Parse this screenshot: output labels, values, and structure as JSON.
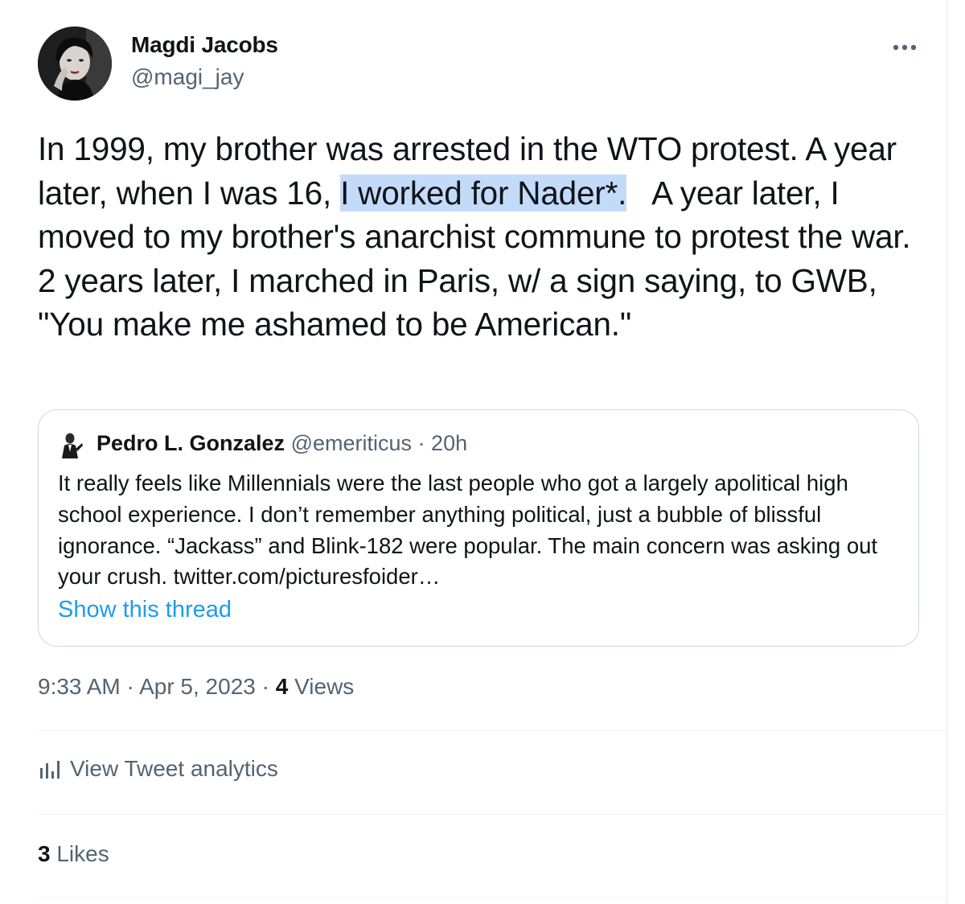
{
  "author": {
    "name": "Magdi Jacobs",
    "handle": "@magi_jay"
  },
  "more_icon": "more-horizontal-icon",
  "tweet": {
    "text_before": "In 1999, my brother was arrested in the WTO protest. A year later, when I was 16, ",
    "text_highlight": "I worked for Nader*.",
    "text_after": "   A year later, I moved to my brother's anarchist commune to protest the war. 2 years later, I marched in Paris, w/ a sign saying, to GWB, \"You make me ashamed to be American.\""
  },
  "quote": {
    "name": "Pedro L. Gonzalez",
    "handle": "@emeriticus",
    "separator": "·",
    "time": "20h",
    "text": "It really feels like Millennials were the last people who got a largely apolitical high school experience. I don’t remember anything political, just a bubble of blissful ignorance. “Jackass” and Blink-182 were popular. The main concern was asking out your crush. twitter.com/picturesfoider…",
    "show_thread": "Show this thread"
  },
  "meta": {
    "time": "9:33 AM",
    "separator": "·",
    "date": "Apr 5, 2023",
    "views_count": "4",
    "views_label": "Views"
  },
  "analytics": {
    "icon": "bar-chart-icon",
    "label": "View Tweet analytics"
  },
  "likes": {
    "count": "3",
    "label": "Likes"
  },
  "colors": {
    "link": "#1d9bf0",
    "secondary_text": "#536471",
    "highlight": "#c3dbf9",
    "border": "#cfd9de"
  }
}
